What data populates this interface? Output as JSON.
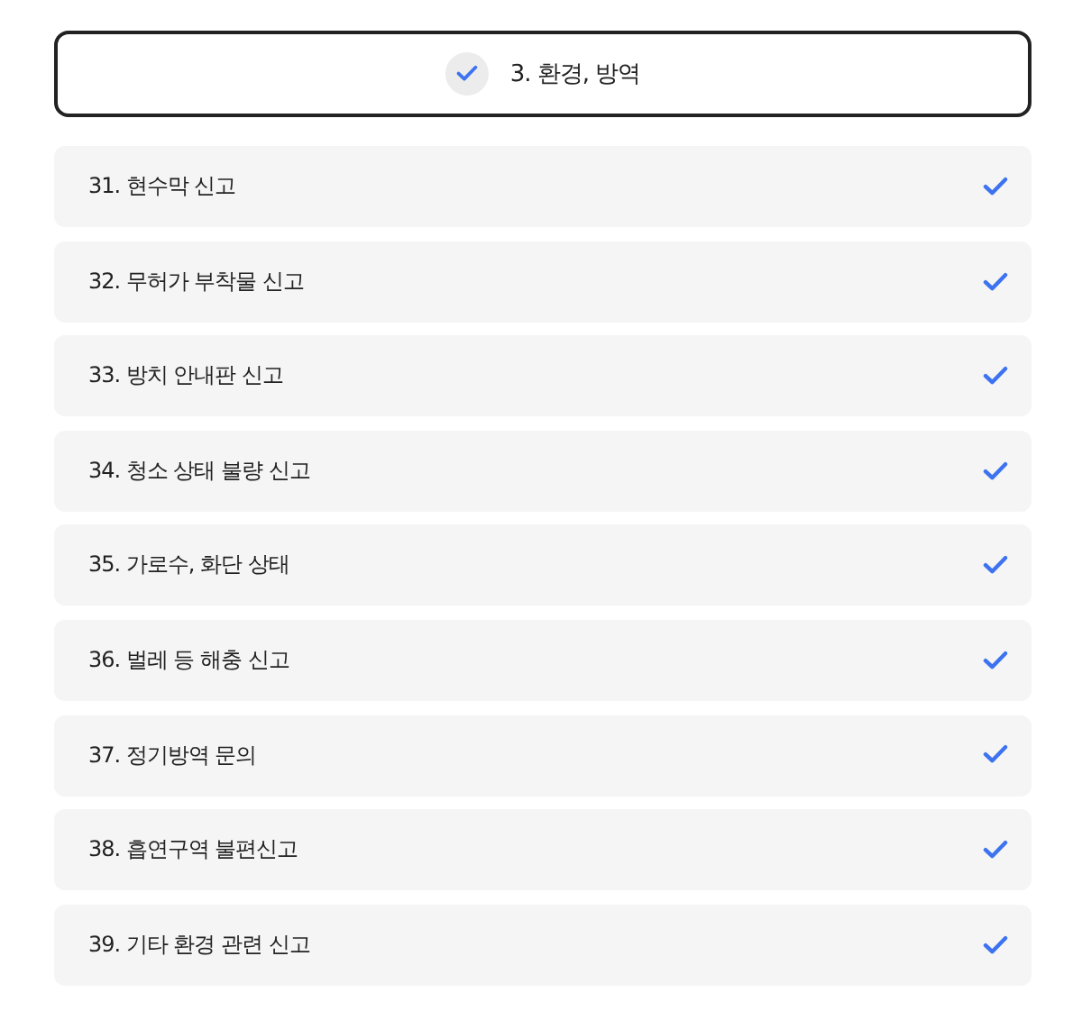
{
  "header": {
    "title": "3. 환경, 방역",
    "checked": true
  },
  "items": [
    {
      "label": "31. 현수막 신고",
      "checked": true
    },
    {
      "label": "32. 무허가 부착물 신고",
      "checked": true
    },
    {
      "label": "33. 방치 안내판 신고",
      "checked": true
    },
    {
      "label": "34. 청소 상태 불량 신고",
      "checked": true
    },
    {
      "label": "35. 가로수, 화단 상태",
      "checked": true
    },
    {
      "label": "36. 벌레 등 해충 신고",
      "checked": true
    },
    {
      "label": "37. 정기방역 문의",
      "checked": true
    },
    {
      "label": "38. 흡연구역 불편신고",
      "checked": true
    },
    {
      "label": "39. 기타 환경 관련 신고",
      "checked": true
    }
  ]
}
